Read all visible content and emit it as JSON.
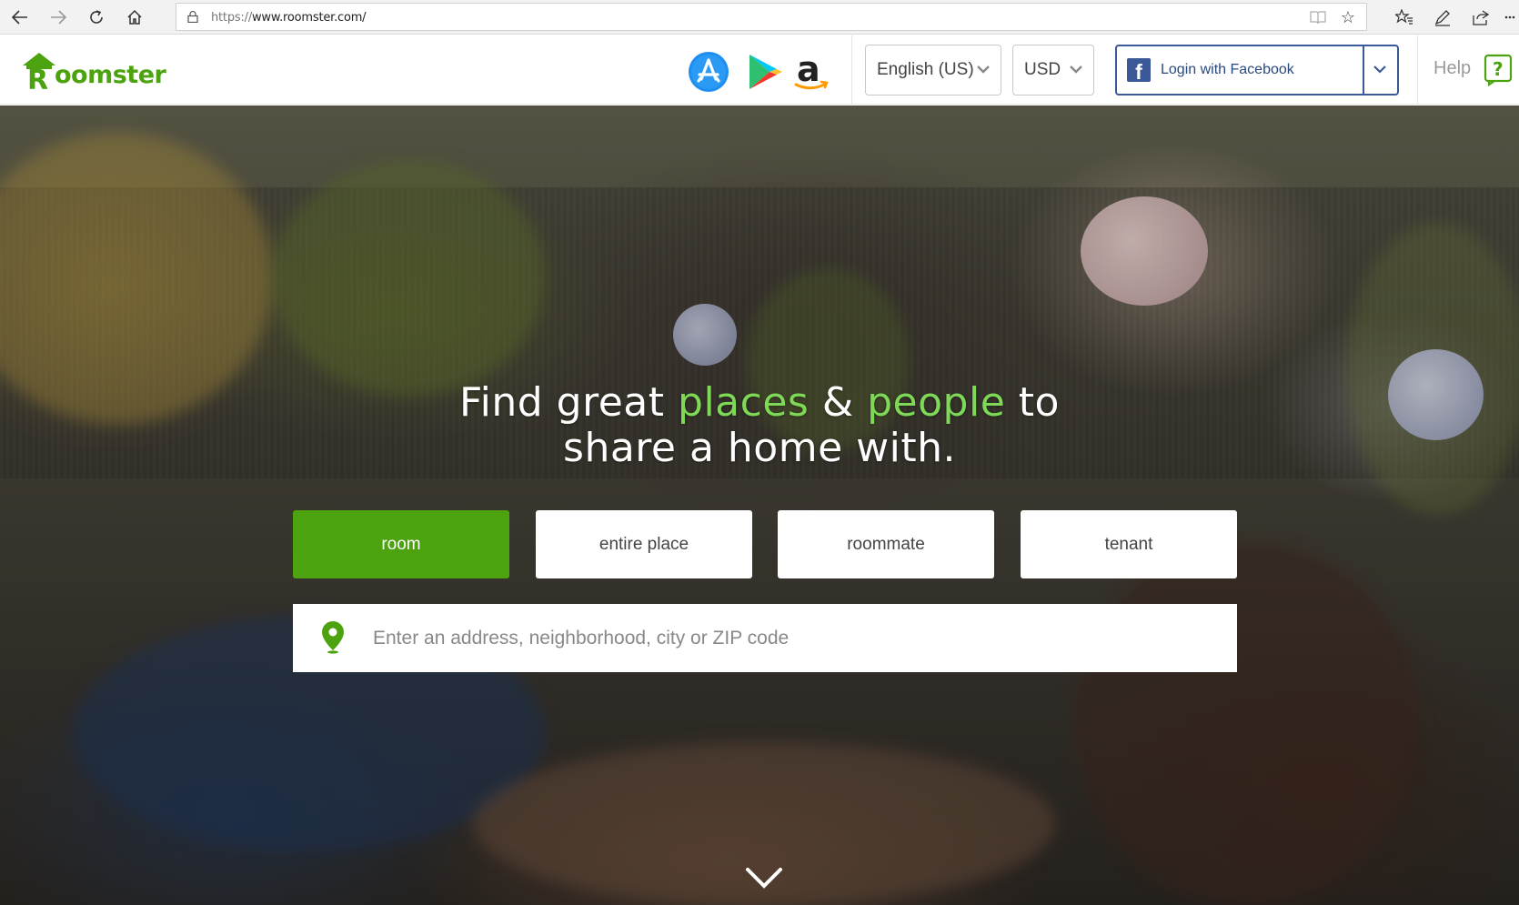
{
  "browser": {
    "url_protocol": "https://",
    "url_host": "www.roomster.com/",
    "icons": [
      "back-icon",
      "forward-icon",
      "refresh-icon",
      "home-icon",
      "lock-icon",
      "reading-view-icon",
      "favorite-star-icon",
      "favorites-hub-icon",
      "web-note-icon",
      "share-icon",
      "more-icon"
    ]
  },
  "header": {
    "logo_initial": "R",
    "logo_text": "oomster",
    "app_store_icons": [
      "app-store-icon",
      "google-play-icon",
      "amazon-icon"
    ],
    "language": "English (US)",
    "currency": "USD",
    "login_label": "Login with Facebook",
    "help_label": "Help",
    "brand_color": "#4ca20f",
    "facebook_color": "#3b5998"
  },
  "hero": {
    "headline_1a": "Find great ",
    "headline_1b": "places",
    "headline_1c": " & ",
    "headline_1d": "people",
    "headline_1e": " to",
    "headline_2": "share a home with.",
    "accent_color": "#7ed957",
    "tabs": [
      {
        "label": "room",
        "active": true
      },
      {
        "label": "entire place",
        "active": false
      },
      {
        "label": "roommate",
        "active": false
      },
      {
        "label": "tenant",
        "active": false
      }
    ],
    "search_placeholder": "Enter an address, neighborhood, city or ZIP code"
  }
}
